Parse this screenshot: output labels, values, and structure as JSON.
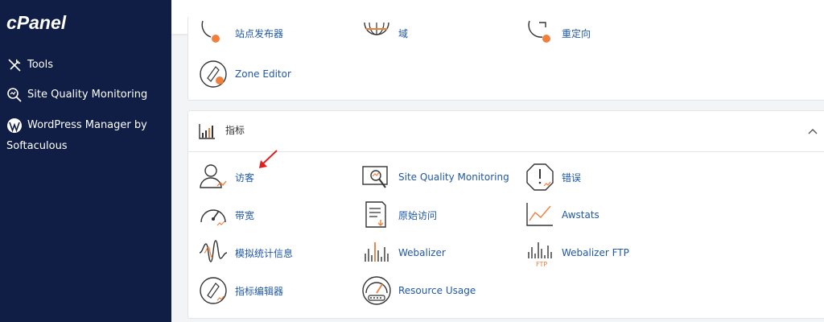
{
  "sidebar": {
    "logo_text": "cPanel",
    "items": [
      {
        "label": "Tools",
        "icon": "tools-icon"
      },
      {
        "label": "Site Quality Monitoring",
        "icon": "search-icon"
      },
      {
        "label": "WordPress Manager by",
        "label2": "Softaculous",
        "icon": "wordpress-icon"
      }
    ]
  },
  "top_panel": {
    "items": [
      {
        "label": "站点发布器",
        "icon": "site-publisher-icon"
      },
      {
        "label": "域",
        "icon": "domains-icon"
      },
      {
        "label": "重定向",
        "icon": "redirects-icon"
      },
      {
        "label": "Zone Editor",
        "icon": "zone-editor-icon"
      }
    ]
  },
  "metrics": {
    "title": "指标",
    "items": [
      {
        "label": "访客",
        "icon": "visitors-icon"
      },
      {
        "label": "Site Quality Monitoring",
        "icon": "site-quality-icon"
      },
      {
        "label": "错误",
        "icon": "errors-icon"
      },
      {
        "label": "带宽",
        "icon": "bandwidth-icon"
      },
      {
        "label": "原始访问",
        "icon": "raw-access-icon"
      },
      {
        "label": "Awstats",
        "icon": "awstats-icon"
      },
      {
        "label": "模拟统计信息",
        "icon": "analog-stats-icon"
      },
      {
        "label": "Webalizer",
        "icon": "webalizer-icon"
      },
      {
        "label": "Webalizer FTP",
        "icon": "webalizer-ftp-icon"
      },
      {
        "label": "指标编辑器",
        "icon": "metrics-editor-icon"
      },
      {
        "label": "Resource Usage",
        "icon": "resource-usage-icon"
      }
    ]
  },
  "colors": {
    "sidebar_bg": "#101d45",
    "link": "#1f58a6",
    "accent_orange": "#f07f3c",
    "arrow_red": "#e02020"
  }
}
